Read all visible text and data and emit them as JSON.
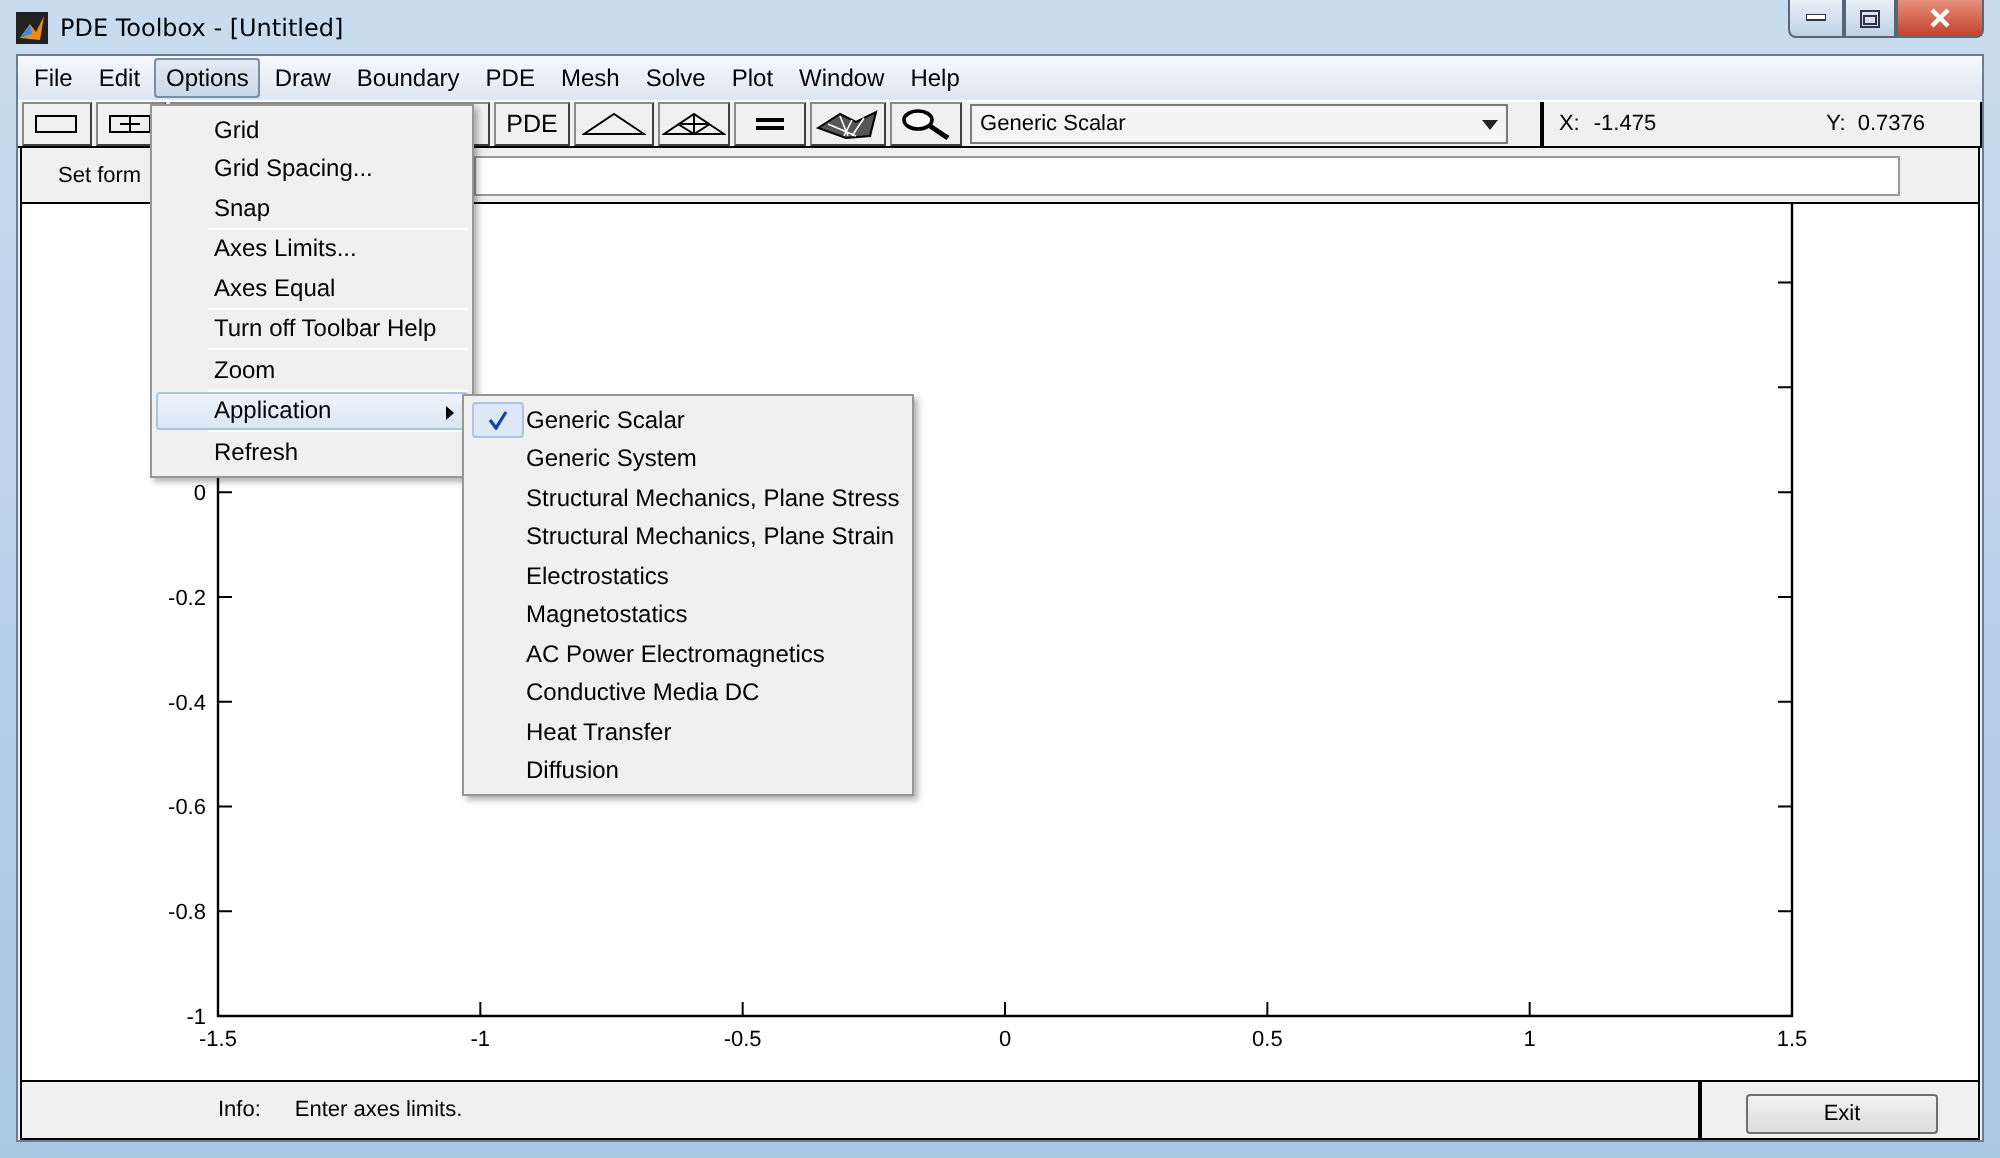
{
  "window": {
    "title": "PDE Toolbox - [Untitled]"
  },
  "menu_bar": [
    {
      "label": "File",
      "selected": false
    },
    {
      "label": "Edit",
      "selected": false
    },
    {
      "label": "Options",
      "selected": true
    },
    {
      "label": "Draw",
      "selected": false
    },
    {
      "label": "Boundary",
      "selected": false
    },
    {
      "label": "PDE",
      "selected": false
    },
    {
      "label": "Mesh",
      "selected": false
    },
    {
      "label": "Solve",
      "selected": false
    },
    {
      "label": "Plot",
      "selected": false
    },
    {
      "label": "Window",
      "selected": false
    },
    {
      "label": "Help",
      "selected": false
    }
  ],
  "toolbar": {
    "pde_button": "PDE",
    "application_select": {
      "value": "Generic Scalar"
    }
  },
  "cursor": {
    "x_label": "X:",
    "x_value": "-1.475",
    "y_label": "Y:",
    "y_value": "0.7376"
  },
  "formula": {
    "label": "Set form"
  },
  "options_menu": {
    "groups": [
      [
        {
          "label": "Grid",
          "selected": false,
          "has_submenu": false
        },
        {
          "label": "Grid Spacing...",
          "selected": false,
          "has_submenu": false
        },
        {
          "label": "Snap",
          "selected": false,
          "has_submenu": false
        }
      ],
      [
        {
          "label": "Axes Limits...",
          "selected": false,
          "has_submenu": false
        },
        {
          "label": "Axes Equal",
          "selected": false,
          "has_submenu": false
        }
      ],
      [
        {
          "label": "Turn off Toolbar Help",
          "selected": false,
          "has_submenu": false
        }
      ],
      [
        {
          "label": "Zoom",
          "selected": false,
          "has_submenu": false
        }
      ],
      [
        {
          "label": "Application",
          "selected": true,
          "has_submenu": true
        }
      ],
      [
        {
          "label": "Refresh",
          "selected": false,
          "has_submenu": false
        }
      ]
    ]
  },
  "application_menu": [
    {
      "label": "Generic Scalar",
      "checked": true
    },
    {
      "label": "Generic System",
      "checked": false
    },
    {
      "label": "Structural Mechanics, Plane Stress",
      "checked": false
    },
    {
      "label": "Structural Mechanics, Plane Strain",
      "checked": false
    },
    {
      "label": "Electrostatics",
      "checked": false
    },
    {
      "label": "Magnetostatics",
      "checked": false
    },
    {
      "label": "AC Power Electromagnetics",
      "checked": false
    },
    {
      "label": "Conductive Media DC",
      "checked": false
    },
    {
      "label": "Heat Transfer",
      "checked": false
    },
    {
      "label": "Diffusion",
      "checked": false
    }
  ],
  "plot": {
    "chart_data": {
      "type": "line",
      "xlim": [
        -1.5,
        1.5
      ],
      "ylim": [
        -1,
        0.55
      ],
      "xticks": [
        -1.5,
        -1,
        -0.5,
        0,
        0.5,
        1,
        1.5
      ],
      "yticks": [
        -1,
        -0.8,
        -0.6,
        -0.4,
        -0.2,
        0
      ]
    }
  },
  "status_bar": {
    "label": "Info:",
    "message": "Enter axes limits.",
    "exit_button": "Exit"
  }
}
